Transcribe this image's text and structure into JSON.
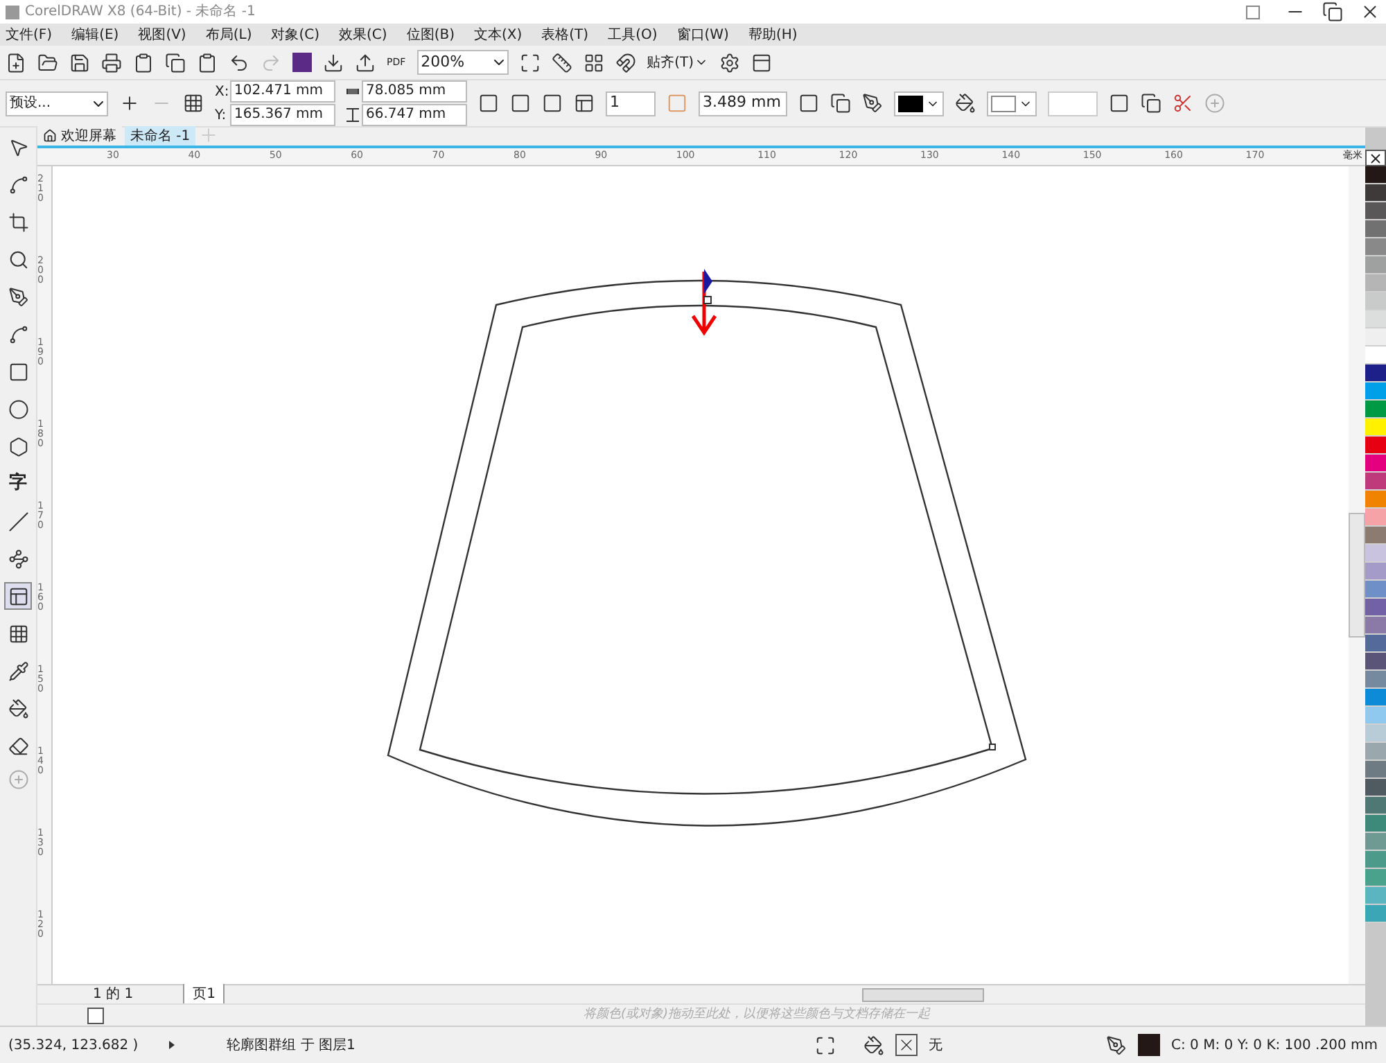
{
  "window": {
    "title": "CorelDRAW X8 (64-Bit) - 未命名 -1"
  },
  "menu": [
    "文件(F)",
    "编辑(E)",
    "视图(V)",
    "布局(L)",
    "对象(C)",
    "效果(C)",
    "位图(B)",
    "文本(X)",
    "表格(T)",
    "工具(O)",
    "窗口(W)",
    "帮助(H)"
  ],
  "toolbar": {
    "pdf_label": "PDF",
    "zoom": "200%",
    "snap": "贴齐(T)"
  },
  "property_bar": {
    "preset": "预设...",
    "x_label": "X:",
    "x": "102.471 mm",
    "y_label": "Y:",
    "y": "165.367 mm",
    "width": "78.085 mm",
    "height": "66.747 mm",
    "steps": "1",
    "offset": "3.489 mm"
  },
  "tabs": [
    {
      "label": "欢迎屏幕",
      "selected": false
    },
    {
      "label": "未命名 -1",
      "selected": true
    }
  ],
  "ruler": {
    "unit": "毫米",
    "x_labels": [
      "30",
      "40",
      "50",
      "60",
      "70",
      "80",
      "90",
      "100",
      "110",
      "120",
      "130",
      "140",
      "150",
      "160",
      "170"
    ],
    "y_labels": [
      "210",
      "200",
      "190",
      "180",
      "170",
      "160",
      "150",
      "140",
      "130",
      "120"
    ]
  },
  "tools": [
    {
      "selected": false
    },
    {
      "selected": false
    },
    {
      "selected": false
    },
    {
      "selected": false
    },
    {
      "selected": false
    },
    {
      "selected": false
    },
    {
      "selected": false
    },
    {
      "selected": false
    },
    {
      "selected": false
    },
    {
      "selected": false,
      "glyph": "字"
    },
    {
      "selected": false
    },
    {
      "selected": false
    },
    {
      "selected": true
    },
    {
      "selected": false
    },
    {
      "selected": false
    },
    {
      "selected": false
    },
    {
      "selected": false
    }
  ],
  "page_nav": {
    "counter": "1 的 1",
    "page_tab": "页1"
  },
  "color_dock": {
    "hint": "将颜色(或对象)拖动至此处，以便将这些颜色与文档存储在一起"
  },
  "palette": [
    {
      "color": "#231815"
    },
    {
      "color": "#3e3a39"
    },
    {
      "color": "#595757"
    },
    {
      "color": "#727171"
    },
    {
      "color": "#898989"
    },
    {
      "color": "#9fa0a0"
    },
    {
      "color": "#b5b5b6"
    },
    {
      "color": "#c9caca"
    },
    {
      "color": "#dcdddd"
    },
    {
      "color": "#efefef"
    },
    {
      "color": "#ffffff"
    },
    {
      "color": "#1d2088"
    },
    {
      "color": "#00a0e9"
    },
    {
      "color": "#009944"
    },
    {
      "color": "#fff100"
    },
    {
      "color": "#e60012"
    },
    {
      "color": "#e4007f"
    },
    {
      "color": "#be3a7a"
    },
    {
      "color": "#f08300"
    },
    {
      "color": "#f5a3a7"
    },
    {
      "color": "#8c7b70"
    },
    {
      "color": "#c9c3e0"
    },
    {
      "color": "#a49bc9"
    },
    {
      "color": "#6f8fc8"
    },
    {
      "color": "#7361a8"
    },
    {
      "color": "#8b7aa8"
    },
    {
      "color": "#536a9a"
    },
    {
      "color": "#5a5478"
    },
    {
      "color": "#758a9e"
    },
    {
      "color": "#0d8bd6"
    },
    {
      "color": "#8fc9ef"
    },
    {
      "color": "#b7ccd6"
    },
    {
      "color": "#9aa8ae"
    },
    {
      "color": "#6e7b82"
    },
    {
      "color": "#4f5a61"
    },
    {
      "color": "#4f7874"
    },
    {
      "color": "#3e8a7a"
    },
    {
      "color": "#6f9a94"
    },
    {
      "color": "#4b9a8a"
    },
    {
      "color": "#4aa28c"
    },
    {
      "color": "#5ab5c0"
    },
    {
      "color": "#3aa6b6"
    }
  ],
  "status_bar": {
    "coordinates": "(35.324, 123.682 )",
    "object_info": "轮廓图群组 于 图层1",
    "fill": "无",
    "outline": "C: 0 M: 0 Y: 0 K: 100  .200 mm"
  }
}
